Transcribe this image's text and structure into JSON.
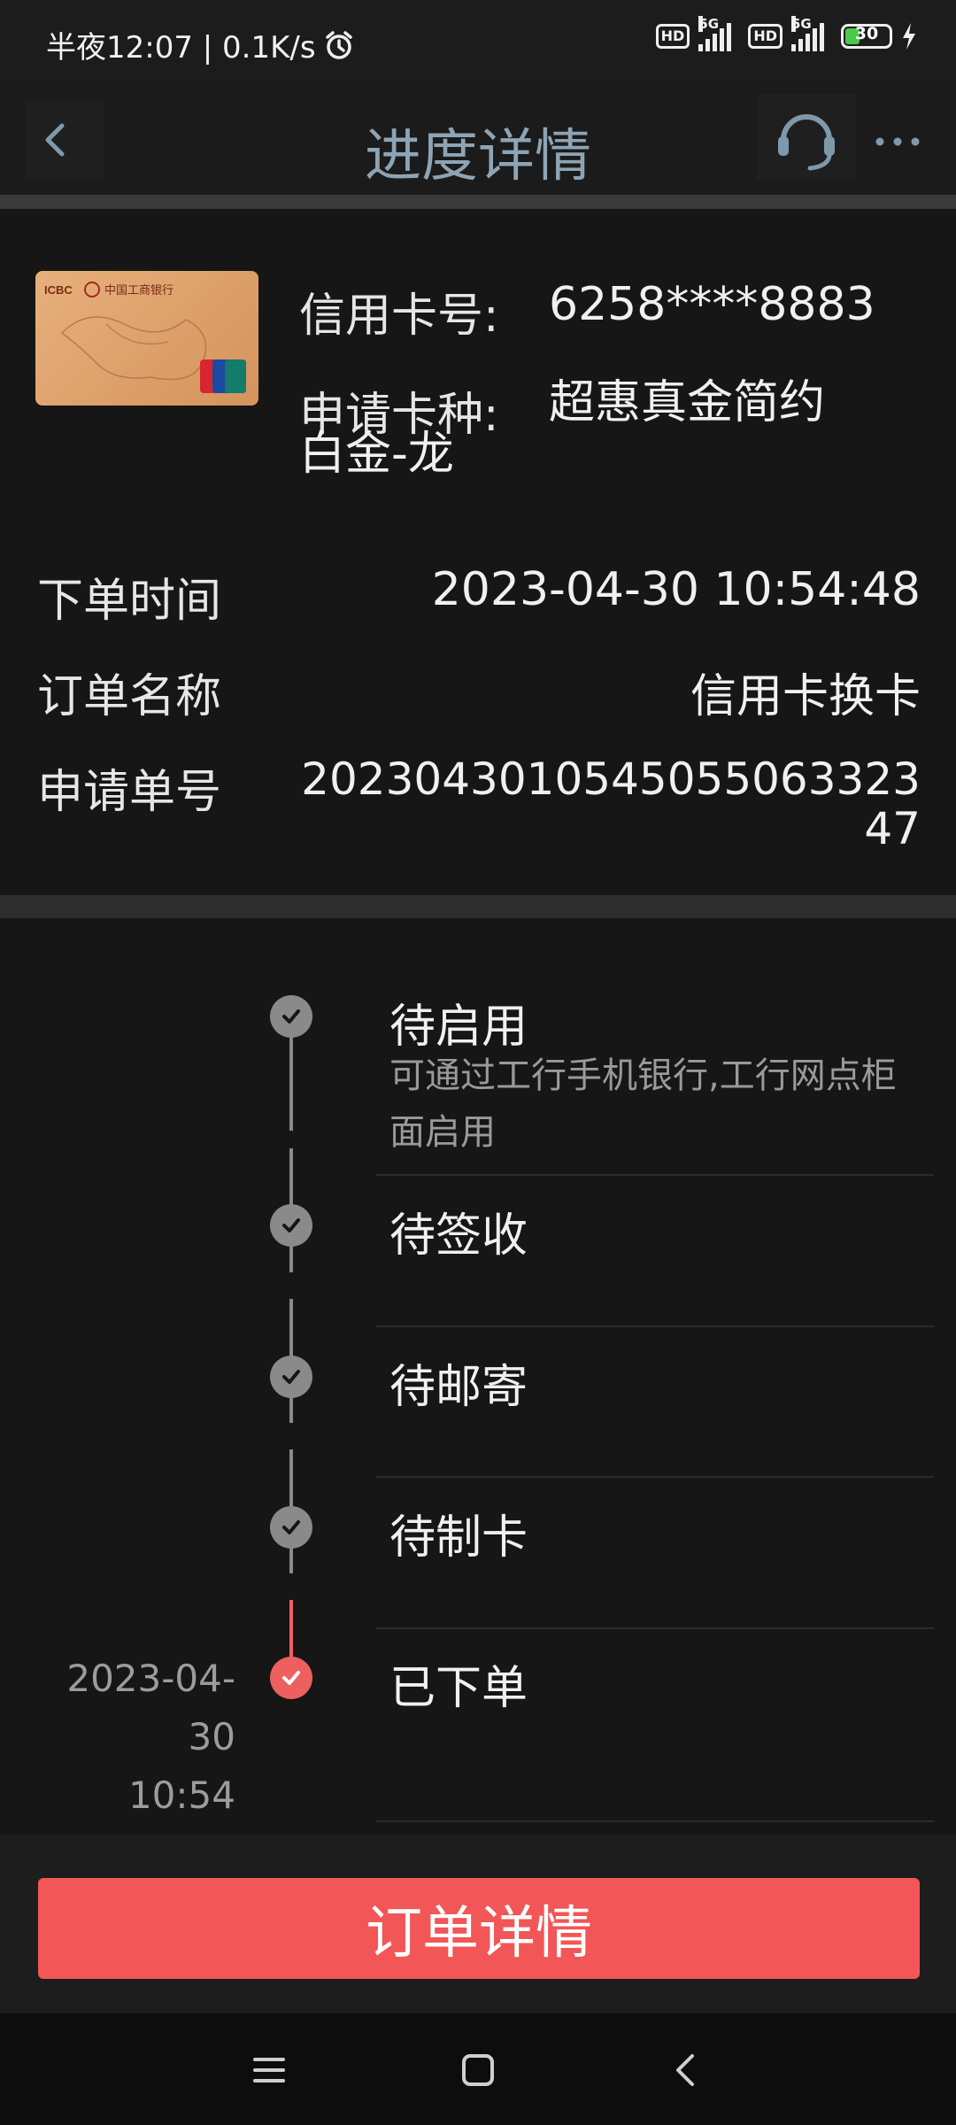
{
  "status_bar": {
    "time_text": "半夜12:07 | 0.1K/s",
    "network_1": "5G",
    "network_2": "5G",
    "hd_label": "HD",
    "battery_level": "30"
  },
  "header": {
    "title": "进度详情",
    "icons": [
      "back-arrow-icon",
      "headset-icon",
      "more-icon"
    ]
  },
  "card": {
    "bank_name_on_card": "中国工商银行",
    "bank_code_on_card": "ICBC",
    "number_label": "信用卡号:",
    "number_value": "6258****8883",
    "type_label": "申请卡种:",
    "type_value": "超惠真金简约白金-龙"
  },
  "order": {
    "time_label": "下单时间",
    "time_value": "2023-04-30 10:54:48",
    "name_label": "订单名称",
    "name_value": "信用卡换卡",
    "number_label": "申请单号",
    "number_value": "2023043010545055063323 47"
  },
  "timeline": [
    {
      "title": "待启用",
      "desc": "可通过工行手机银行,工行网点柜面启用",
      "date": "",
      "time": ""
    },
    {
      "title": "待签收",
      "desc": "",
      "date": "",
      "time": ""
    },
    {
      "title": "待邮寄",
      "desc": "",
      "date": "",
      "time": ""
    },
    {
      "title": "待制卡",
      "desc": "",
      "date": "",
      "time": ""
    },
    {
      "title": "已下单",
      "desc": "",
      "date": "2023-04-30",
      "time": "10:54"
    }
  ],
  "timeline_date_lines": [
    "2023-04-",
    "30",
    "10:54"
  ],
  "bottom": {
    "order_detail_button": "订单详情"
  },
  "colors": {
    "accent": "#f25656",
    "title": "#8ea4b4",
    "timeline_inactive": "#8a8a8a",
    "timeline_active": "#ee6060",
    "battery": "#4cc94c"
  }
}
